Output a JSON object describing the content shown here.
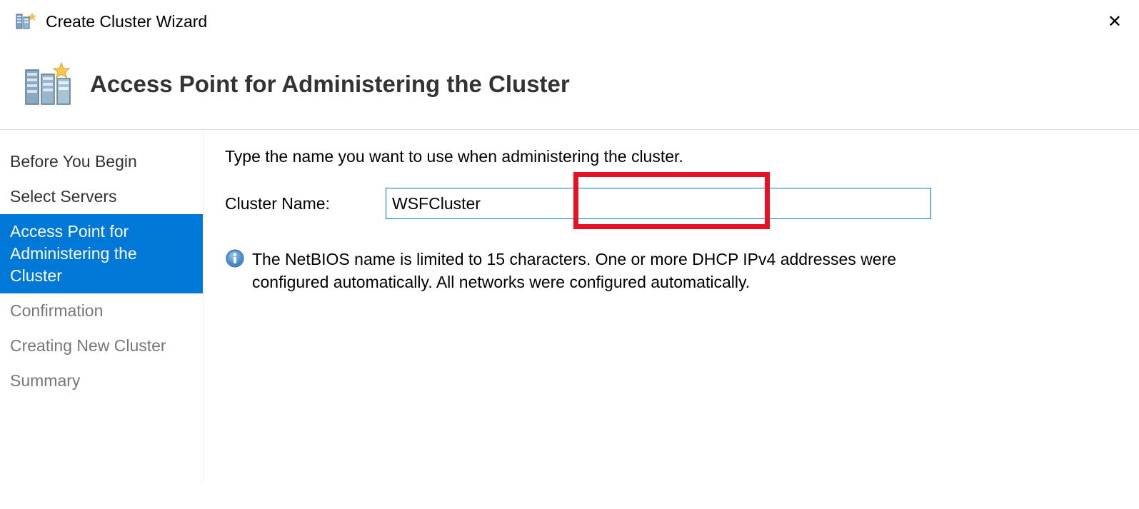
{
  "window": {
    "title": "Create Cluster Wizard"
  },
  "banner": {
    "title": "Access Point for Administering the Cluster"
  },
  "sidebar": {
    "items": [
      {
        "label": "Before You Begin",
        "state": "normal"
      },
      {
        "label": "Select Servers",
        "state": "normal"
      },
      {
        "label": "Access Point for Administering the Cluster",
        "state": "active"
      },
      {
        "label": "Confirmation",
        "state": "disabled"
      },
      {
        "label": "Creating New Cluster",
        "state": "disabled"
      },
      {
        "label": "Summary",
        "state": "disabled"
      }
    ]
  },
  "main": {
    "instruction": "Type the name you want to use when administering the cluster.",
    "cluster_name_label": "Cluster Name:",
    "cluster_name_value": "WSFCluster",
    "info_text": "The NetBIOS name is limited to 15 characters.  One or more DHCP IPv4 addresses were configured automatically.  All networks were configured automatically."
  }
}
